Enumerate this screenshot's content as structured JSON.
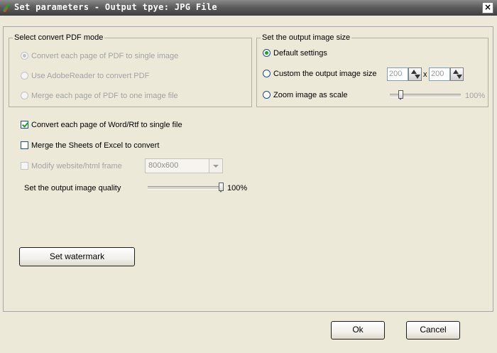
{
  "window": {
    "title": "Set parameters - Output tpye: JPG File",
    "close_symbol": "×"
  },
  "pdf_mode": {
    "legend": "Select convert PDF mode",
    "options": [
      "Convert each page of PDF to single image",
      "Use AdobeReader to convert PDF",
      "Merge each page of PDF to one image file"
    ]
  },
  "image_size": {
    "legend": "Set the output image size",
    "default_label": "Default settings",
    "custom_label": "Custom the output image size",
    "width_value": "200",
    "separator": "x",
    "height_value": "200",
    "zoom_label": "Zoom image as scale",
    "zoom_percent": "100%",
    "zoom_level": 0.15
  },
  "options": {
    "word_label": "Convert each page of Word/Rtf to single file",
    "excel_label": "Merge the Sheets of Excel to convert",
    "website_label": "Modify website/html frame",
    "frame_value": "800x600"
  },
  "quality": {
    "label": "Set the output image quality",
    "percent": "100%",
    "level": 1.0
  },
  "buttons": {
    "watermark": "Set watermark",
    "ok": "Ok",
    "cancel": "Cancel"
  }
}
